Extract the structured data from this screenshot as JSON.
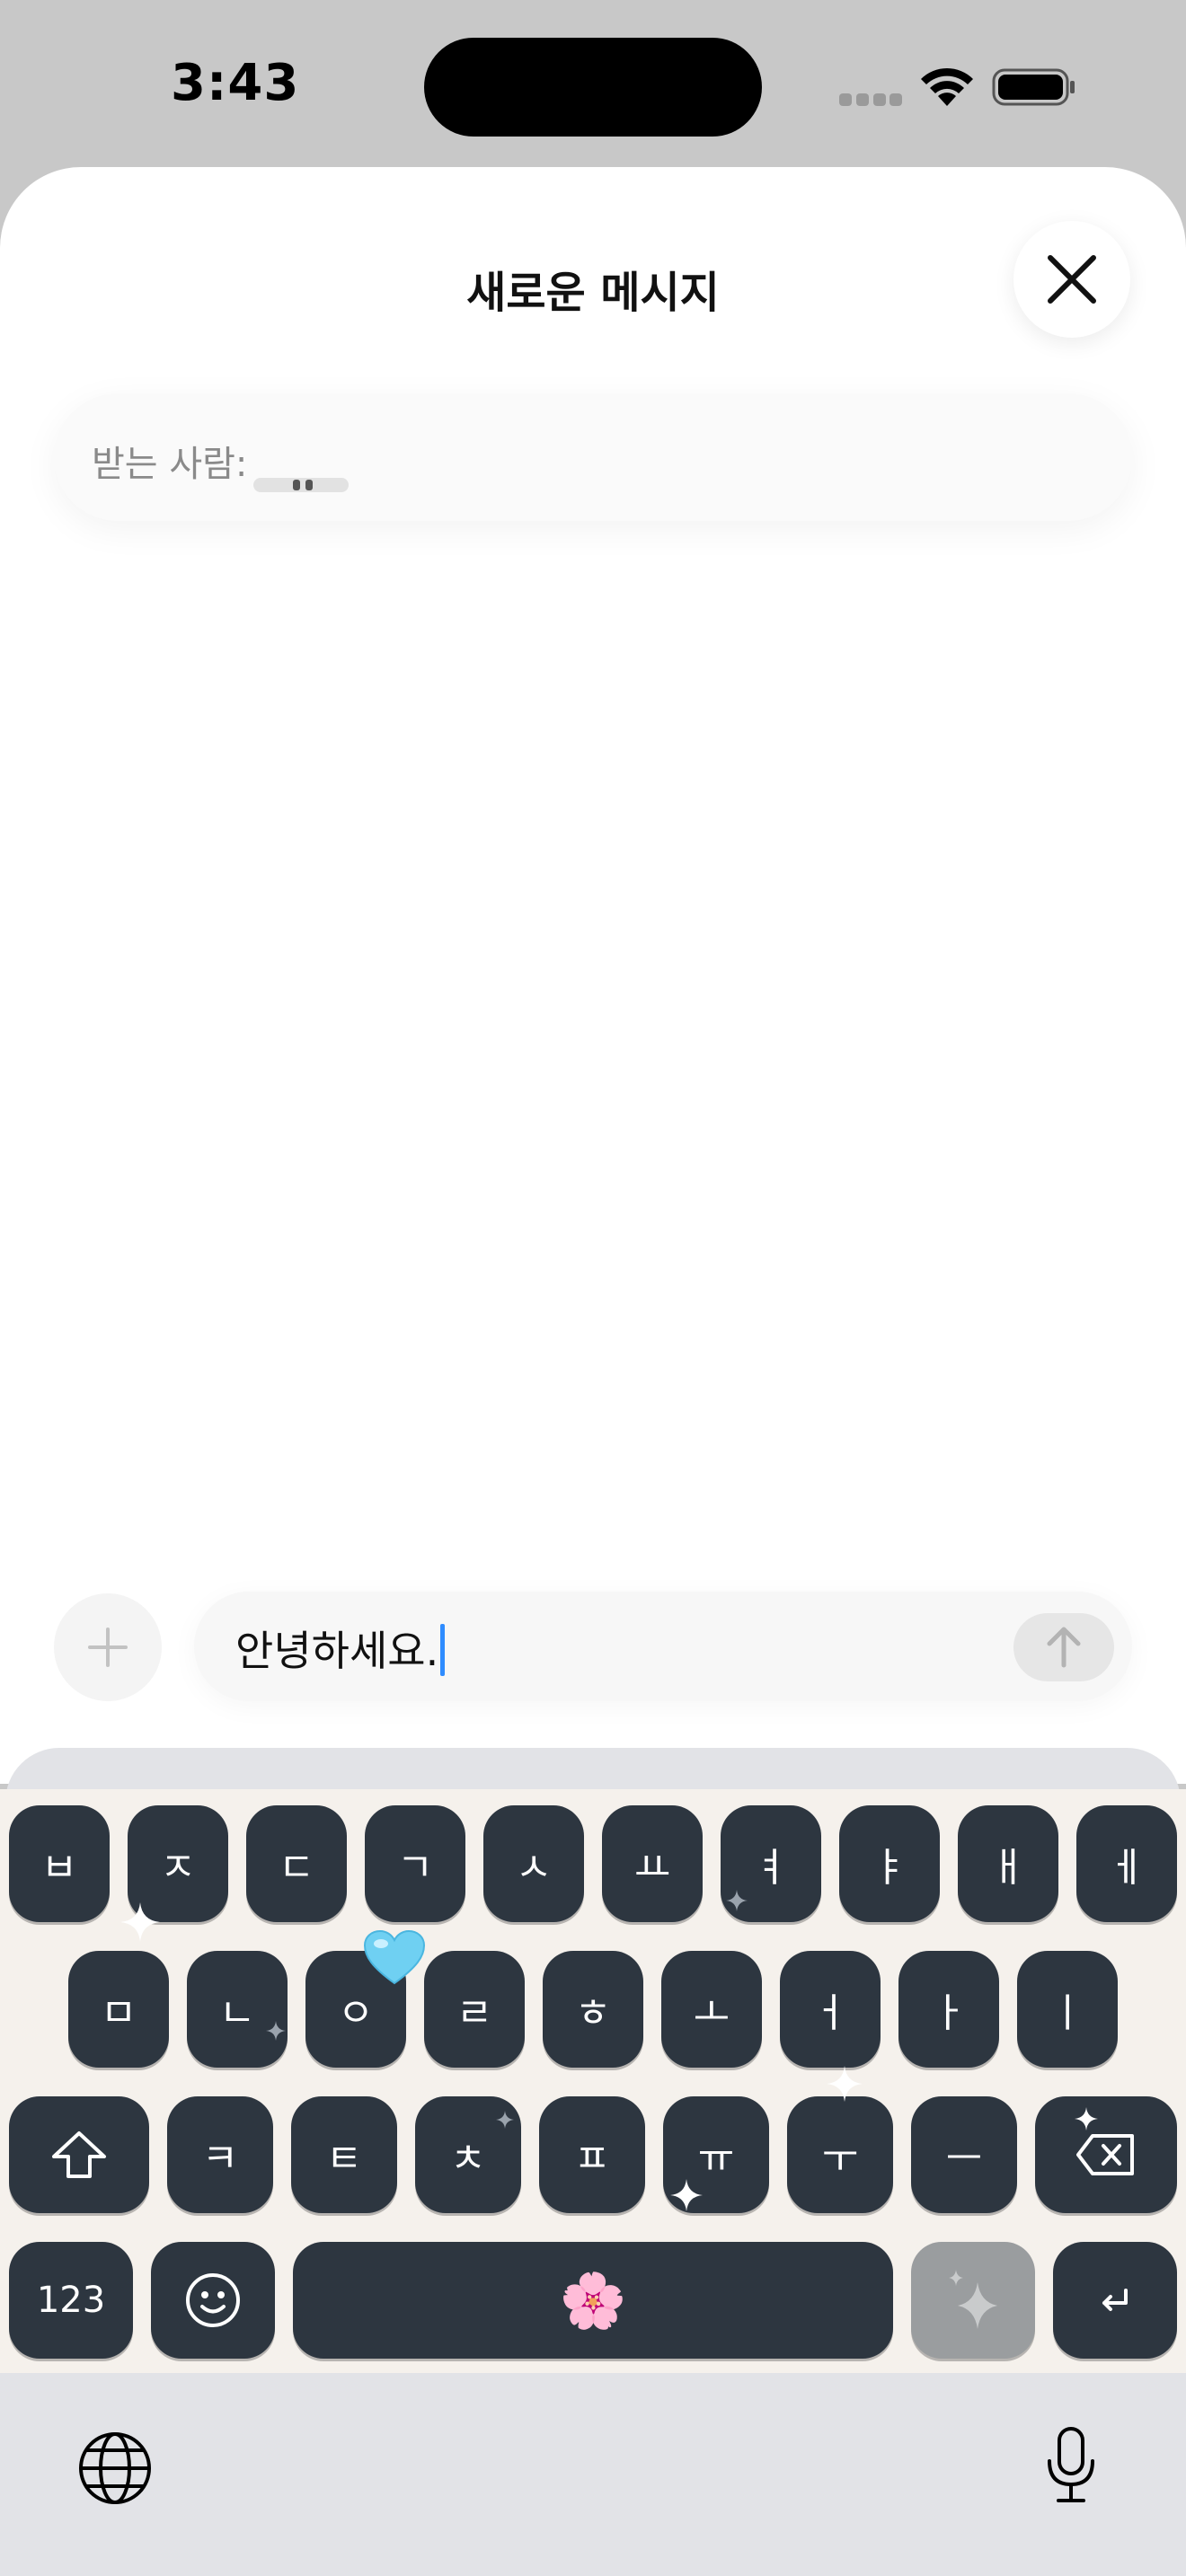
{
  "status_bar": {
    "time": "3:43"
  },
  "sheet": {
    "title": "새로운 메시지",
    "recipient_label": "받는 사람:"
  },
  "compose": {
    "message_text": "안녕하세요."
  },
  "keyboard": {
    "theme": {
      "key_color": "#2d3640",
      "background": "#f5f1ec",
      "ai_key_color": "#9a9d9f"
    },
    "row1": [
      "ㅂ",
      "ㅈ",
      "ㄷ",
      "ㄱ",
      "ㅅ",
      "ㅛ",
      "ㅕ",
      "ㅑ",
      "ㅐ",
      "ㅔ"
    ],
    "row2": [
      "ㅁ",
      "ㄴ",
      "ㅇ",
      "ㄹ",
      "ㅎ",
      "ㅗ",
      "ㅓ",
      "ㅏ",
      "ㅣ"
    ],
    "row3": [
      "ㅋ",
      "ㅌ",
      "ㅊ",
      "ㅍ",
      "ㅠ",
      "ㅜ",
      "ㅡ"
    ],
    "numbers_label": "123",
    "space_emoji": "🌸",
    "decor_emoji": "🩵",
    "icons": [
      "shift-icon",
      "delete-icon",
      "emoji-icon",
      "sparkles-icon",
      "return-icon",
      "globe-icon",
      "microphone-icon"
    ]
  }
}
